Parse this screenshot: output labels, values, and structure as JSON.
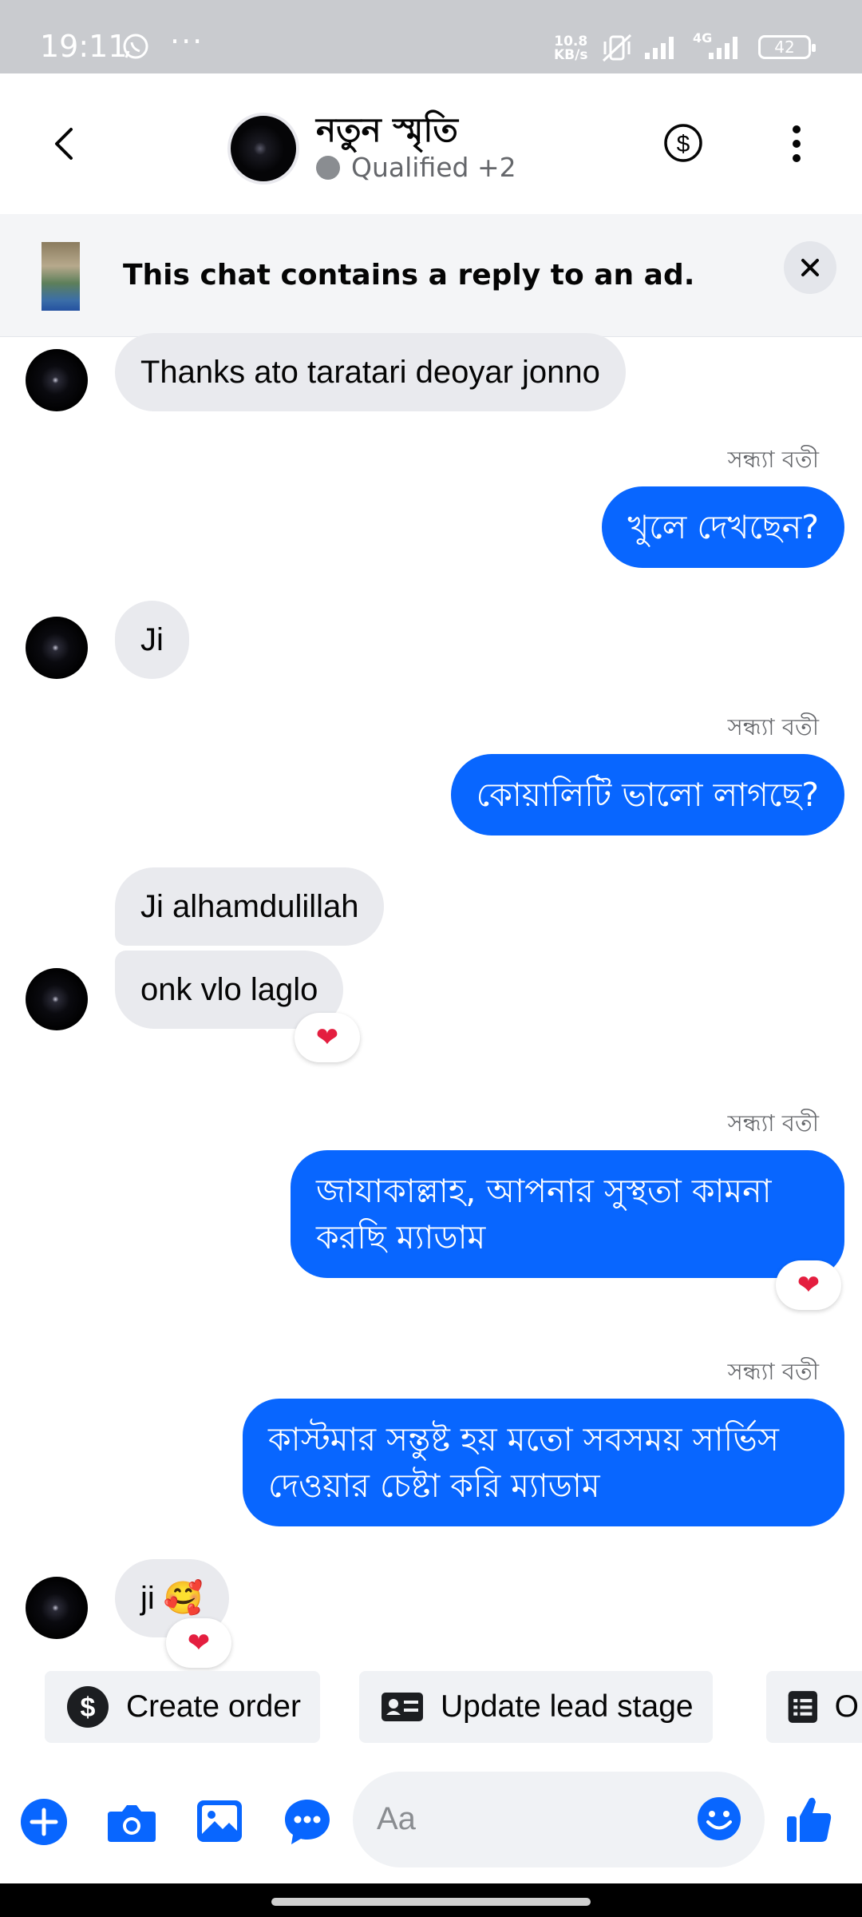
{
  "status_bar": {
    "time": "19:11",
    "more": "···",
    "net_speed_value": "10.8",
    "net_speed_unit": "KB/s",
    "network_label": "4G",
    "battery": "42"
  },
  "header": {
    "contact_name": "নতুন স্মৃতি",
    "contact_subtitle": "Qualified +2"
  },
  "ad_banner": {
    "text": "This chat contains a reply to an ad."
  },
  "messages": [
    {
      "dir": "in",
      "text": "Thanks ato taratari deoyar jonno"
    },
    {
      "dir": "out",
      "sender": "সন্ধ্যা বতী",
      "text": "খুলে দেখছেন?"
    },
    {
      "dir": "in",
      "text": "Ji"
    },
    {
      "dir": "out",
      "sender": "সন্ধ্যা বতী",
      "text": "কোয়ালিটি ভালো লাগছে?"
    },
    {
      "dir": "in",
      "text": "Ji alhamdulillah"
    },
    {
      "dir": "in",
      "text": "onk vlo laglo",
      "reaction": "❤"
    },
    {
      "dir": "out",
      "sender": "সন্ধ্যা বতী",
      "line1": "জাযাকাল্লাহ, আপনার সুস্থতা কামনা",
      "line2": "করছি ম্যাডাম",
      "reaction": "❤"
    },
    {
      "dir": "out",
      "sender": "সন্ধ্যা বতী",
      "line1": "কাস্টমার সন্তুষ্ট হয় মতো সবসময় সার্ভিস",
      "line2": "দেওয়ার চেষ্টা করি ম্যাডাম"
    },
    {
      "dir": "in",
      "text": "ji 🥰",
      "reaction": "❤"
    }
  ],
  "quick_actions": [
    {
      "label": "Create order",
      "icon": "dollar-circle-icon"
    },
    {
      "label": "Update lead stage",
      "icon": "contact-card-icon"
    },
    {
      "label": "O",
      "icon": "list-document-icon"
    }
  ],
  "composer": {
    "placeholder": "Aa"
  },
  "colors": {
    "accent": "#0866ff",
    "incoming_bubble": "#e9eaee",
    "reaction_heart": "#e41e3f"
  }
}
